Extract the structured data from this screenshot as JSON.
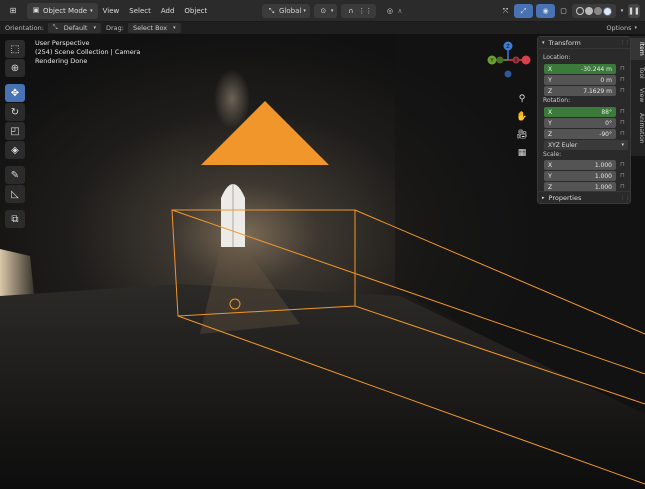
{
  "header": {
    "mode_label": "Object Mode",
    "menus": [
      "View",
      "Select",
      "Add",
      "Object"
    ],
    "orientation_value": "Global",
    "options_label": "Options"
  },
  "tool_settings": {
    "orientation_label": "Orientation:",
    "orientation_value": "Default",
    "drag_label": "Drag:",
    "drag_value": "Select Box"
  },
  "viewport": {
    "perspective": "User Perspective",
    "collection": "(254) Scene Collection | Camera",
    "status": "Rendering Done",
    "gizmo_labels": {
      "z": "Z",
      "y": "Y",
      "x": "X"
    }
  },
  "npanel": {
    "section_title": "Transform",
    "location_label": "Location:",
    "location": [
      {
        "axis": "X",
        "value": "-30.244 m"
      },
      {
        "axis": "Y",
        "value": "0 m"
      },
      {
        "axis": "Z",
        "value": "7.1629 m"
      }
    ],
    "rotation_label": "Rotation:",
    "rotation": [
      {
        "axis": "X",
        "value": "88°"
      },
      {
        "axis": "Y",
        "value": "0°"
      },
      {
        "axis": "Z",
        "value": "-90°"
      }
    ],
    "rotation_mode": "XYZ Euler",
    "scale_label": "Scale:",
    "scale": [
      {
        "axis": "X",
        "value": "1.000"
      },
      {
        "axis": "Y",
        "value": "1.000"
      },
      {
        "axis": "Z",
        "value": "1.000"
      }
    ],
    "properties_title": "Properties",
    "tabs": [
      "Item",
      "Tool",
      "View",
      "Animation"
    ]
  },
  "colors": {
    "accent_blue": "#4772b3",
    "camera_orange": "#f0962b",
    "gizmo_x": "#d8414c",
    "gizmo_y": "#6ca02e",
    "gizmo_z": "#3f7bd3"
  }
}
